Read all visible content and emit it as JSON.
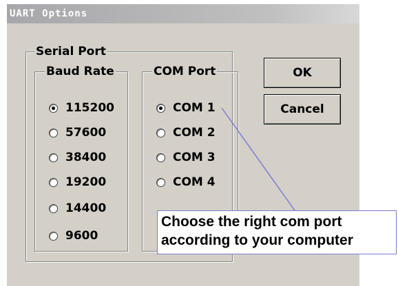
{
  "window": {
    "title": "UART Options"
  },
  "serial_port": {
    "label": "Serial Port",
    "baud_rate": {
      "label": "Baud Rate",
      "selected": "115200",
      "options": [
        "115200",
        "57600",
        "38400",
        "19200",
        "14400",
        "9600"
      ]
    },
    "com_port": {
      "label": "COM Port",
      "selected": "COM 1",
      "options": [
        "COM 1",
        "COM 2",
        "COM 3",
        "COM 4"
      ]
    }
  },
  "buttons": {
    "ok": "OK",
    "cancel": "Cancel"
  },
  "annotation": {
    "line1": "Choose the right com port",
    "line2": "according to your computer",
    "line_color": "#7b7bd6"
  }
}
